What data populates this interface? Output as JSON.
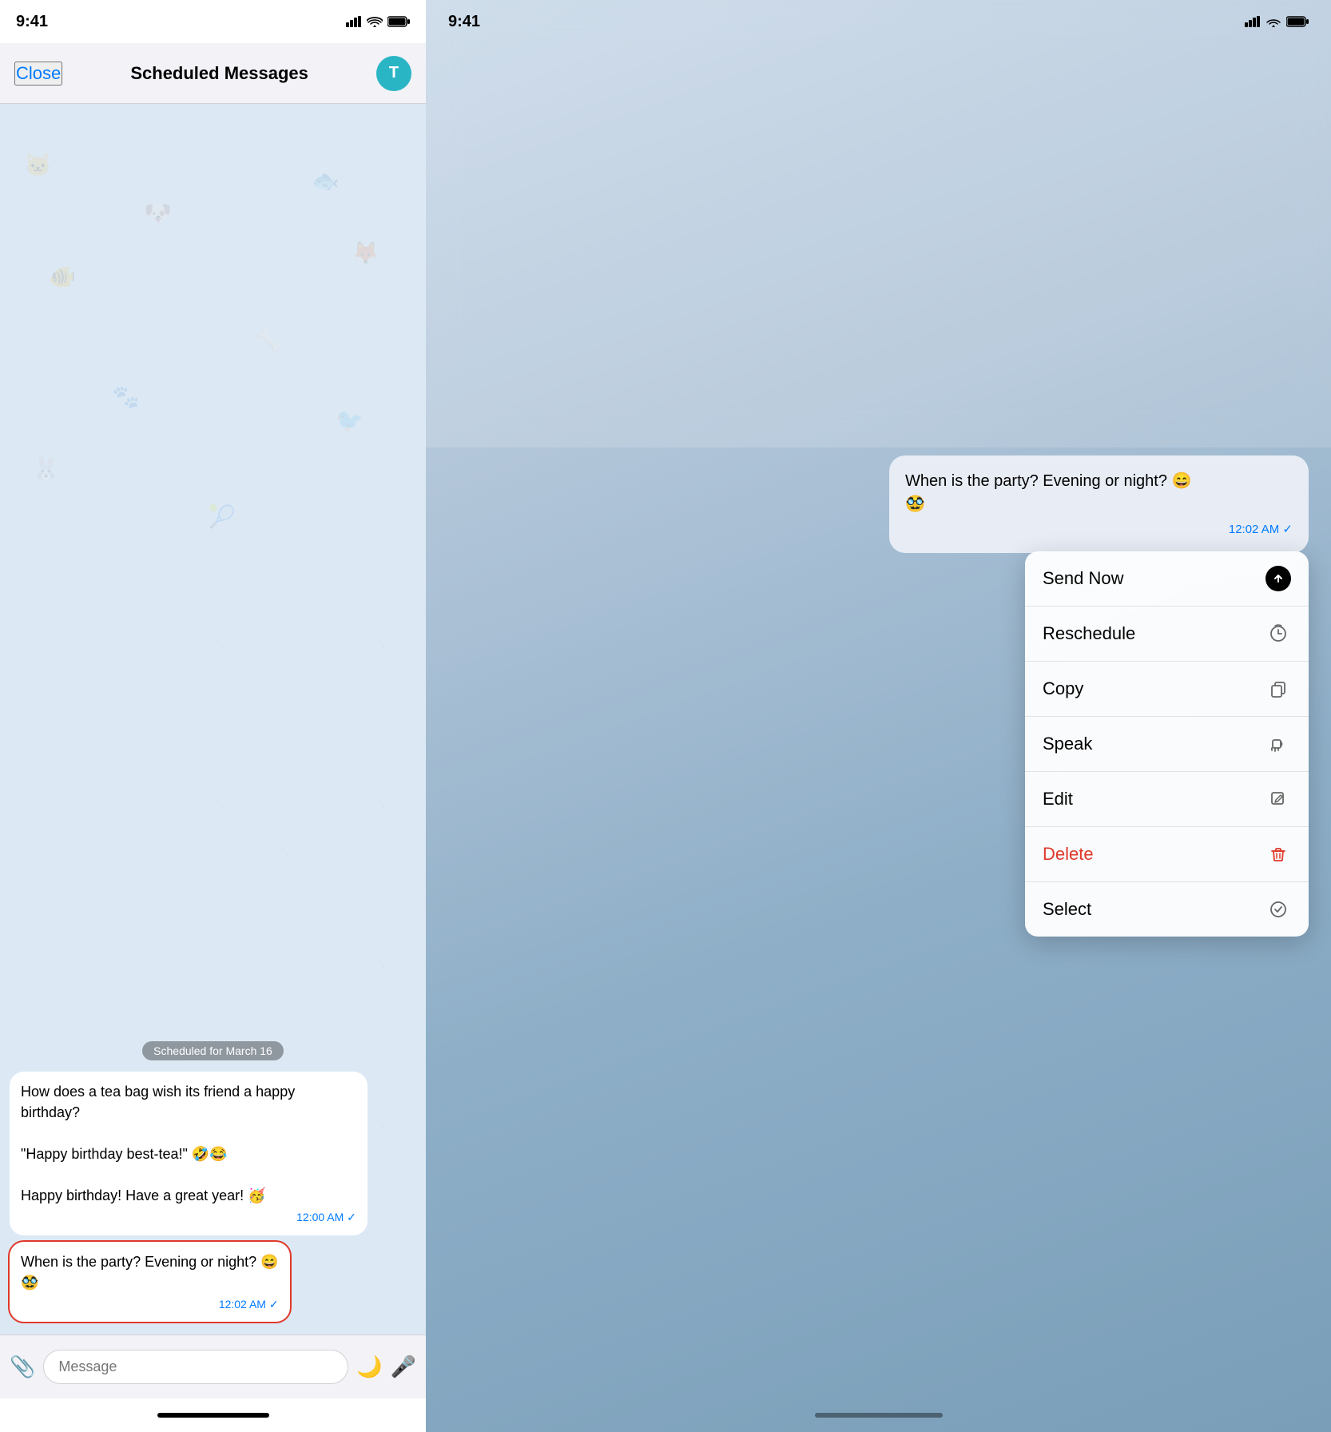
{
  "left": {
    "statusBar": {
      "time": "9:41",
      "signal": "▲▲▲",
      "wifi": "wifi",
      "battery": "battery"
    },
    "navBar": {
      "closeLabel": "Close",
      "title": "Scheduled Messages",
      "avatarInitial": "T"
    },
    "dateBadge": "Scheduled for March 16",
    "messages": [
      {
        "id": "msg1",
        "text": "How does a tea bag wish its friend a happy birthday?\n\n\"Happy birthday best-tea!\" 🤣😂\n\nHappy birthday! Have a great year! 🥳",
        "time": "12:00 AM",
        "selected": false
      },
      {
        "id": "msg2",
        "text": "When is the party? Evening or night? 😄\n🥸",
        "time": "12:02 AM",
        "selected": true
      }
    ],
    "inputBar": {
      "placeholder": "Message"
    }
  },
  "right": {
    "statusBar": {
      "time": "9:41"
    },
    "messageBubble": {
      "text": "When is the party? Evening or night? 😄\n🥸",
      "time": "12:02 AM"
    },
    "contextMenu": {
      "items": [
        {
          "id": "send-now",
          "label": "Send Now",
          "iconType": "send",
          "isDelete": false
        },
        {
          "id": "reschedule",
          "label": "Reschedule",
          "iconType": "clock",
          "isDelete": false
        },
        {
          "id": "copy",
          "label": "Copy",
          "iconType": "copy",
          "isDelete": false
        },
        {
          "id": "speak",
          "label": "Speak",
          "iconType": "speak",
          "isDelete": false
        },
        {
          "id": "edit",
          "label": "Edit",
          "iconType": "edit",
          "isDelete": false
        },
        {
          "id": "delete",
          "label": "Delete",
          "iconType": "trash",
          "isDelete": true
        },
        {
          "id": "select",
          "label": "Select",
          "iconType": "select",
          "isDelete": false
        }
      ]
    }
  }
}
